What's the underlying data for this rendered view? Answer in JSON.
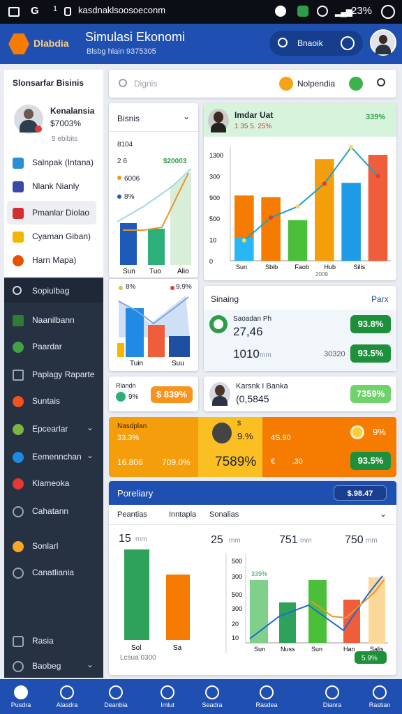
{
  "statusbar": {
    "url": "kasdnaklsoosoeconm",
    "battery": "23%"
  },
  "appbar": {
    "logo": "Dlabdia",
    "title": "Simulasi Ekonomi",
    "subtitle": "Blsbg hlain 9375305",
    "search_label": "Bnaoik"
  },
  "sidebar": {
    "header": "Slonsarfar Bisinis",
    "profile": {
      "name": "Kenalansia",
      "value": "$7003%",
      "sub": "5 ebibits"
    },
    "items": [
      {
        "label": "Salnpak (Intana)",
        "color": "#2a8fd6"
      },
      {
        "label": "Nlank Nianly",
        "color": "#3a49a8"
      },
      {
        "label": "Pmanlar Diolao",
        "color": "#d32f2f"
      },
      {
        "label": "Cyaman Giban)",
        "color": "#f2b705"
      },
      {
        "label": "Harn Mapa)",
        "color": "#e65100"
      }
    ],
    "dark_items": [
      {
        "label": "Sopiulbag",
        "color": "#9aa6b8"
      },
      {
        "label": "Naanilbann",
        "color": "#2e7d32"
      },
      {
        "label": "Paardar",
        "color": "#43a047"
      },
      {
        "label": "Paplagy Raparte",
        "color": "#9aa6b8"
      },
      {
        "label": "Suntais",
        "color": "#f4511e"
      },
      {
        "label": "Epcearlar",
        "color": "#7cb342"
      },
      {
        "label": "Eemennchan",
        "color": "#1e88e5"
      },
      {
        "label": "Klameoka",
        "color": "#e53935"
      },
      {
        "label": "Cahatann",
        "color": "#9aa6b8"
      },
      {
        "label": "Sonlarl",
        "color": "#f9a825"
      },
      {
        "label": "Canatliania",
        "color": "#9aa6b8"
      },
      {
        "label": "Rasia",
        "color": "#9aa6b8"
      },
      {
        "label": "Baobeg",
        "color": "#9aa6b8"
      }
    ]
  },
  "searchbar": {
    "placeholder": "Dignis",
    "button": "Nolpendia"
  },
  "card_bisnis": {
    "title": "Bisnis",
    "v1": "8104",
    "v2": "2 6",
    "l1": "$20003",
    "l2": "6006",
    "l3": "8%",
    "cats": [
      "Sun",
      "Tuo",
      "Alio"
    ],
    "pct1": "8%",
    "pct2": "9.9%",
    "lower_cats": [
      "Tuin",
      "Suu"
    ]
  },
  "card_inda": {
    "title": "Imdar Uat",
    "sub": "1 35 5. 25%",
    "pct": "339%",
    "yticks": [
      "1300",
      "300",
      "900",
      "500",
      "10",
      "0"
    ],
    "xlabels": [
      "Sun",
      "Sbib",
      "Faob",
      "Hub",
      "Silis"
    ],
    "footer": "2009"
  },
  "chart_bar": {
    "type": "bar",
    "categories": [
      "Sun",
      "Sbib",
      "Faob",
      "Hub",
      "Silis"
    ],
    "series": [
      {
        "values": [
          770,
          750,
          480,
          1200,
          920,
          1250
        ]
      }
    ],
    "line": [
      240,
      510,
      640,
      910,
      1340,
      1000
    ],
    "ylim": [
      0,
      1300
    ]
  },
  "card_sinaing": {
    "title": "Sinaing",
    "link": "Parx",
    "name": "Saoadan Ph",
    "value": "27,46",
    "sub": "1010",
    "unit": "mm",
    "r1": "30320",
    "p1": "93.8%",
    "p2": "93.5%"
  },
  "card_small": {
    "label": "Rlandn",
    "pct": "9%",
    "value": "$ 839%"
  },
  "card_karsh": {
    "name": "Karsnk I Banka",
    "value": "(0,5845",
    "pill": "7359%"
  },
  "orange_band": {
    "left_label": "Nasdplan",
    "left_val": "33.3%",
    "left_a": "16.806",
    "left_b": "709.0%",
    "mid_pct": "9.%",
    "big": "7589%",
    "right_a": "4S.90",
    "right_b": "€        .30",
    "right_pct": "9%",
    "right_pill": "93.5%"
  },
  "portfolio": {
    "title": "Poreliary",
    "pill": "$.98.47",
    "tabs": [
      "Peantias",
      "Inntapla",
      "Sonalias"
    ],
    "stats": [
      {
        "v": "15",
        "u": "mm"
      },
      {
        "v": "25",
        "u": "mm"
      },
      {
        "v": "751",
        "u": "mm"
      },
      {
        "v": "750",
        "u": "mm"
      }
    ],
    "leftcats": [
      "Sol",
      "Sa"
    ],
    "footer": "Lcsua 0300",
    "pill2": "5.9%",
    "rcats": [
      "Sun",
      "Nuss",
      "Sun",
      "Han",
      "Salis"
    ],
    "rpct": "339%",
    "rticks": [
      "500",
      "300",
      "500",
      "300",
      "20",
      "10",
      "0"
    ]
  },
  "bottomnav": [
    "Pusdra",
    "Alasdra",
    "Deanbia",
    "Imlut",
    "Seadra",
    "Rasdea",
    "Dianra",
    "Rastian"
  ]
}
